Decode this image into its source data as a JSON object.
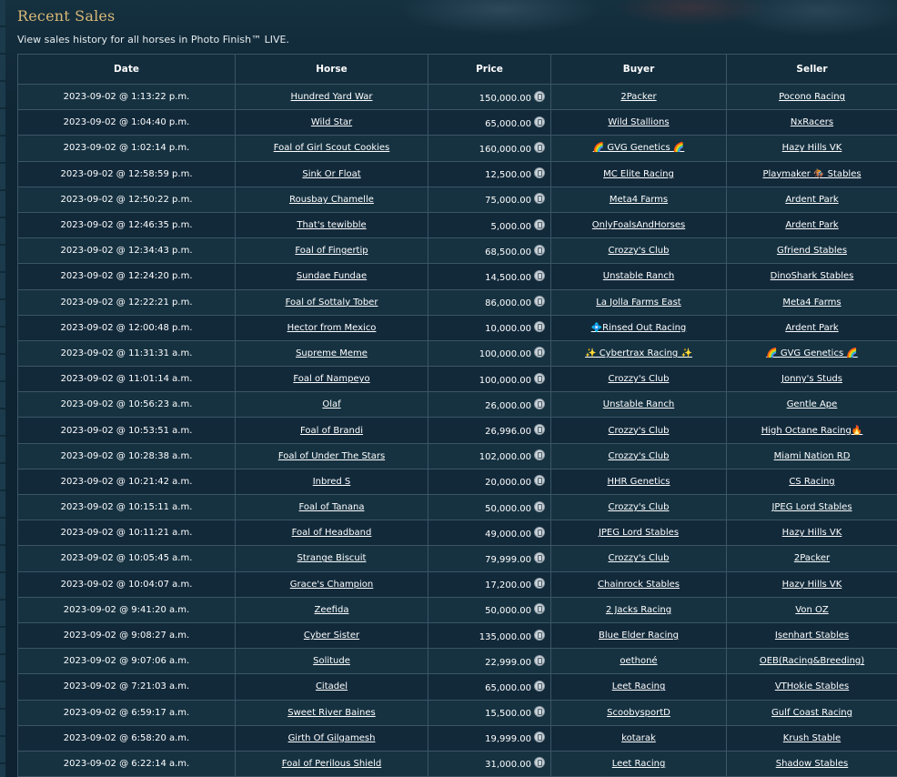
{
  "page": {
    "title": "Recent Sales",
    "subtitle": "View sales history for all horses in Photo Finish™ LIVE."
  },
  "table": {
    "headers": [
      "Date",
      "Horse",
      "Price",
      "Buyer",
      "Seller"
    ],
    "currency_icon": "coin-icon",
    "rows": [
      {
        "date": "2023-09-02 @ 1:13:22 p.m.",
        "horse": "Hundred Yard War",
        "price": "150,000.00",
        "buyer": "2Packer",
        "seller": "Pocono Racing"
      },
      {
        "date": "2023-09-02 @ 1:04:40 p.m.",
        "horse": "Wild Star",
        "price": "65,000.00",
        "buyer": "Wild Stallions",
        "seller": "NxRacers"
      },
      {
        "date": "2023-09-02 @ 1:02:14 p.m.",
        "horse": "Foal of Girl Scout Cookies",
        "price": "160,000.00",
        "buyer": "🌈 GVG Genetics 🌈",
        "seller": "Hazy Hills VK"
      },
      {
        "date": "2023-09-02 @ 12:58:59 p.m.",
        "horse": "Sink Or Float",
        "price": "12,500.00",
        "buyer": "MC Elite Racing",
        "seller": "Playmaker 🏇 Stables"
      },
      {
        "date": "2023-09-02 @ 12:50:22 p.m.",
        "horse": "Rousbay Chamelle",
        "price": "75,000.00",
        "buyer": "Meta4 Farms",
        "seller": "Ardent Park"
      },
      {
        "date": "2023-09-02 @ 12:46:35 p.m.",
        "horse": "That's tewibble",
        "price": "5,000.00",
        "buyer": "OnlyFoalsAndHorses",
        "seller": "Ardent Park"
      },
      {
        "date": "2023-09-02 @ 12:34:43 p.m.",
        "horse": "Foal of Fingertip",
        "price": "68,500.00",
        "buyer": "Crozzy's Club",
        "seller": "Gfriend Stables"
      },
      {
        "date": "2023-09-02 @ 12:24:20 p.m.",
        "horse": "Sundae Fundae",
        "price": "14,500.00",
        "buyer": "Unstable Ranch",
        "seller": "DinoShark Stables"
      },
      {
        "date": "2023-09-02 @ 12:22:21 p.m.",
        "horse": "Foal of Sottaly Tober",
        "price": "86,000.00",
        "buyer": "La Jolla Farms East",
        "seller": "Meta4 Farms"
      },
      {
        "date": "2023-09-02 @ 12:00:48 p.m.",
        "horse": "Hector from Mexico",
        "price": "10,000.00",
        "buyer": "💠Rinsed Out Racing",
        "seller": "Ardent Park"
      },
      {
        "date": "2023-09-02 @ 11:31:31 a.m.",
        "horse": "Supreme Meme",
        "price": "100,000.00",
        "buyer": "✨ Cybertrax Racing ✨",
        "seller": "🌈 GVG Genetics 🌈"
      },
      {
        "date": "2023-09-02 @ 11:01:14 a.m.",
        "horse": "Foal of Nampeyo",
        "price": "100,000.00",
        "buyer": "Crozzy's Club",
        "seller": "Jonny's Studs"
      },
      {
        "date": "2023-09-02 @ 10:56:23 a.m.",
        "horse": "Olaf",
        "price": "26,000.00",
        "buyer": "Unstable Ranch",
        "seller": "Gentle Ape"
      },
      {
        "date": "2023-09-02 @ 10:53:51 a.m.",
        "horse": "Foal of Brandi",
        "price": "26,996.00",
        "buyer": "Crozzy's Club",
        "seller": "High Octane Racing🔥"
      },
      {
        "date": "2023-09-02 @ 10:28:38 a.m.",
        "horse": "Foal of Under The Stars",
        "price": "102,000.00",
        "buyer": "Crozzy's Club",
        "seller": "Miami Nation RD"
      },
      {
        "date": "2023-09-02 @ 10:21:42 a.m.",
        "horse": "Inbred S",
        "price": "20,000.00",
        "buyer": "HHR Genetics",
        "seller": "CS Racing"
      },
      {
        "date": "2023-09-02 @ 10:15:11 a.m.",
        "horse": "Foal of Tanana",
        "price": "50,000.00",
        "buyer": "Crozzy's Club",
        "seller": "JPEG Lord Stables"
      },
      {
        "date": "2023-09-02 @ 10:11:21 a.m.",
        "horse": "Foal of Headband",
        "price": "49,000.00",
        "buyer": "JPEG Lord Stables",
        "seller": "Hazy Hills VK"
      },
      {
        "date": "2023-09-02 @ 10:05:45 a.m.",
        "horse": "Strange Biscuit",
        "price": "79,999.00",
        "buyer": "Crozzy's Club",
        "seller": "2Packer"
      },
      {
        "date": "2023-09-02 @ 10:04:07 a.m.",
        "horse": "Grace's Champion",
        "price": "17,200.00",
        "buyer": "Chainrock Stables",
        "seller": "Hazy Hills VK"
      },
      {
        "date": "2023-09-02 @ 9:41:20 a.m.",
        "horse": "Zeefida",
        "price": "50,000.00",
        "buyer": "2 Jacks Racing",
        "seller": "Von OZ"
      },
      {
        "date": "2023-09-02 @ 9:08:27 a.m.",
        "horse": "Cyber Sister",
        "price": "135,000.00",
        "buyer": "Blue Elder Racing",
        "seller": "Isenhart Stables"
      },
      {
        "date": "2023-09-02 @ 9:07:06 a.m.",
        "horse": "Solitude",
        "price": "22,999.00",
        "buyer": "oethoné",
        "seller": "OEB(Racing&Breeding)"
      },
      {
        "date": "2023-09-02 @ 7:21:03 a.m.",
        "horse": "Citadel",
        "price": "65,000.00",
        "buyer": "Leet Racing",
        "seller": "VTHokie Stables"
      },
      {
        "date": "2023-09-02 @ 6:59:17 a.m.",
        "horse": "Sweet River Baines",
        "price": "15,500.00",
        "buyer": "ScoobysportD",
        "seller": "Gulf Coast Racing"
      },
      {
        "date": "2023-09-02 @ 6:58:20 a.m.",
        "horse": "Girth Of Gilgamesh",
        "price": "19,999.00",
        "buyer": "kotarak",
        "seller": "Krush Stable"
      },
      {
        "date": "2023-09-02 @ 6:22:14 a.m.",
        "horse": "Foal of Perilous Shield",
        "price": "31,000.00",
        "buyer": "Leet Racing",
        "seller": "Shadow Stables"
      }
    ]
  }
}
